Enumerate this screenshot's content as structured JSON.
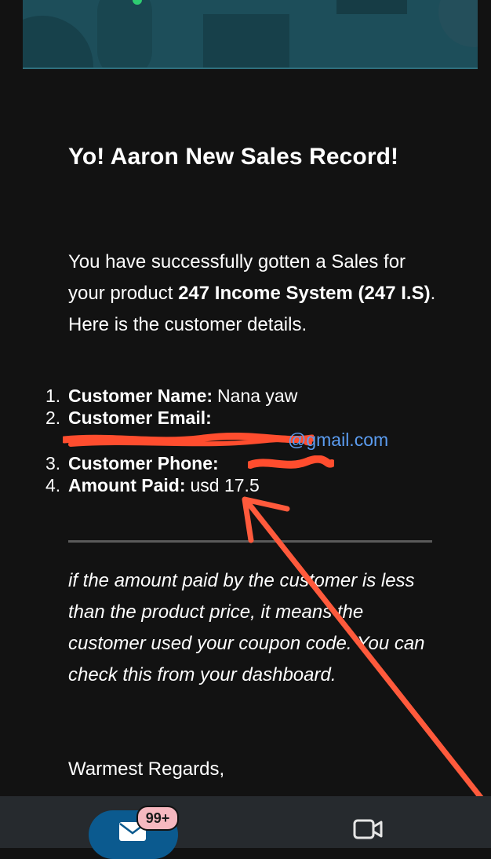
{
  "email": {
    "title": "Yo! Aaron New Sales Record!",
    "intro": {
      "part1": "You have successfully gotten a Sales for your product ",
      "product": "247 Income System (247 I.S)",
      "part2": ". Here is the customer details."
    },
    "details": [
      {
        "num": "1.",
        "label": "Customer Name:",
        "value": "Nana yaw"
      },
      {
        "num": "2.",
        "label": "Customer Email:",
        "value": ""
      },
      {
        "num": "3.",
        "label": "Customer Phone:",
        "value": ""
      },
      {
        "num": "4.",
        "label": "Amount Paid:",
        "value": "usd 17.5"
      }
    ],
    "email_visible": "@gmail.com",
    "note": "if the amount paid by the customer is less than the product price, it means the customer used your coupon code. You can check this from your dashboard.",
    "signoff": "Warmest Regards,"
  },
  "bottom_nav": {
    "mail_badge": "99+",
    "icons": [
      "mail-icon",
      "video-icon"
    ]
  },
  "colors": {
    "background": "#121212",
    "banner": "#1d4e5a",
    "link": "#5b9cf0",
    "annotation": "#ff5a3c",
    "nav_active": "#0b5a8f",
    "badge": "#f6b8c0"
  }
}
